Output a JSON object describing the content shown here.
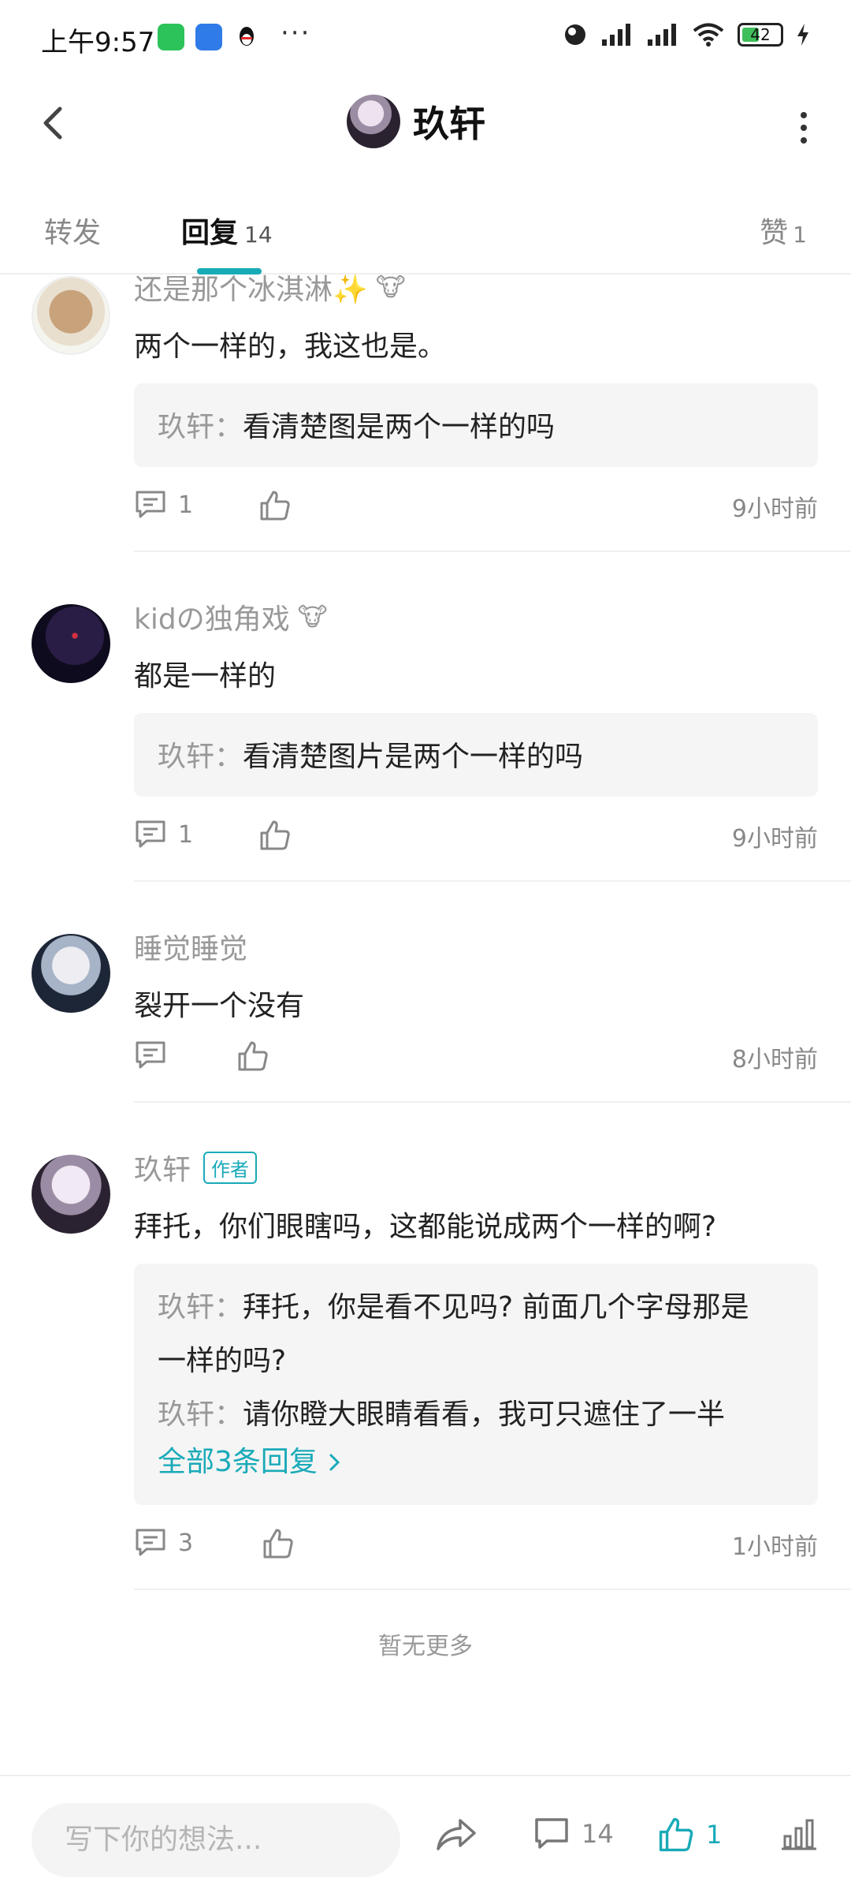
{
  "status_bar": {
    "time": "上午9:57",
    "more": "···",
    "battery": "42"
  },
  "header": {
    "title": "玖轩"
  },
  "tabs": {
    "forward_label": "转发",
    "reply_label": "回复",
    "reply_count": "14",
    "like_label": "赞",
    "like_count": "1"
  },
  "comments": [
    {
      "user": "还是那个冰淇淋✨",
      "text": "两个一样的，我这也是。",
      "quotes": [
        {
          "user": "玖轩",
          "text": "看清楚图是两个一样的吗"
        }
      ],
      "reply_count": "1",
      "time": "9小时前"
    },
    {
      "user": "kidの独角戏",
      "text": "都是一样的",
      "quotes": [
        {
          "user": "玖轩",
          "text": "看清楚图片是两个一样的吗"
        }
      ],
      "reply_count": "1",
      "time": "9小时前"
    },
    {
      "user": "睡觉睡觉",
      "text": "裂开一个没有",
      "time": "8小时前"
    },
    {
      "user": "玖轩",
      "badge": "作者",
      "text": "拜托，你们眼瞎吗，这都能说成两个一样的啊?",
      "quotes": [
        {
          "user": "玖轩",
          "text": "拜托，你是看不见吗? 前面几个字母那是",
          "text_line2": "一样的吗?"
        },
        {
          "user": "玖轩",
          "text": "请你瞪大眼睛看看，我可只遮住了一半"
        }
      ],
      "all_replies": "全部3条回复",
      "reply_count": "3",
      "time": "1小时前"
    }
  ],
  "no_more": "暂无更多",
  "bottom_bar": {
    "input_placeholder": "写下你的想法...",
    "comment_count": "14",
    "like_count": "1"
  },
  "colors": {
    "accent": "#19aab8",
    "quote_bg": "#f5f5f5",
    "muted_text": "#999999"
  }
}
